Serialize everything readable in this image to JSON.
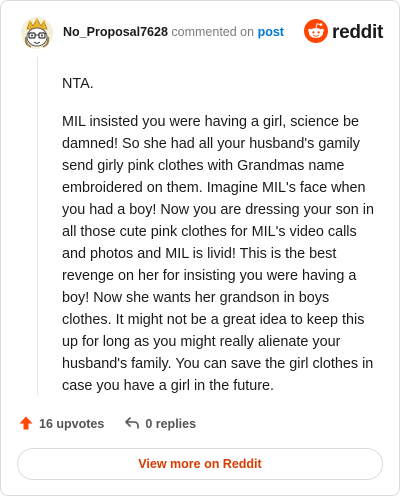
{
  "comment": {
    "author": "No_Proposal7628",
    "action_text": "commented on",
    "target_link": "post",
    "paragraphs": [
      "NTA.",
      "MIL insisted you were having a girl, science be damned! So she had all your husband's gamily send girly pink clothes with Grandmas name embroidered on them. Imagine MIL's face when you had a boy! Now you are dressing your son in all those cute pink clothes for MIL's video calls and photos and MIL is livid! This is the best revenge on her for insisting you were having a boy! Now she wants her grandson in boys clothes. It might not be a great idea to keep this up for long as you might really alienate your husband's family. You can save the girl clothes in case you have a girl in the future."
    ]
  },
  "brand": {
    "wordmark": "reddit",
    "icon": "reddit-snoo-icon",
    "color": "#ff4500"
  },
  "actions": {
    "upvotes_label": "16 upvotes",
    "upvote_icon": "upvote-arrow-icon",
    "upvote_color": "#ff4500",
    "replies_label": "0 replies",
    "reply_icon": "reply-arrow-icon"
  },
  "footer": {
    "view_more_label": "View more on Reddit",
    "view_more_color": "#d93a00"
  },
  "colors": {
    "link": "#0079d3",
    "border": "#dcdcdc"
  }
}
